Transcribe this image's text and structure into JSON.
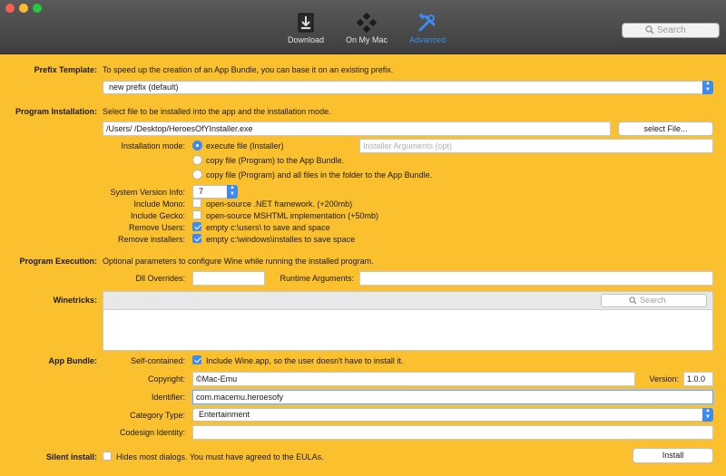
{
  "toolbar": {
    "tabs": [
      {
        "label": "Download",
        "icon": "download-icon"
      },
      {
        "label": "On My Mac",
        "icon": "on-my-mac-icon"
      },
      {
        "label": "Advanced",
        "icon": "advanced-tools-icon"
      }
    ],
    "active_tab": "Advanced",
    "search_placeholder": "Search"
  },
  "prefix": {
    "label": "Prefix Template:",
    "description": "To speed up the creation of an App Bundle, you can base it on an existing prefix.",
    "selected": "new prefix (default)"
  },
  "program_installation": {
    "label": "Program Installation:",
    "description": "Select file to be installed into the app and the installation mode.",
    "file_path": "/Users/            /Desktop/HeroesOfYInstaller.exe",
    "select_file_label": "select File...",
    "mode_label": "Installation mode:",
    "modes": [
      "execute file (Installer)",
      "copy file (Program)  to the App Bundle.",
      "copy file (Program)  and all files in the folder to the App Bundle."
    ],
    "installer_args_placeholder": "Installer Arguments (opt)",
    "system_version_label": "System Version Info:",
    "system_version": "7",
    "options": [
      {
        "label": "Include Mono:",
        "text": "open-source .NET framework. (+200mb)",
        "checked": false
      },
      {
        "label": "Include Gecko:",
        "text": "open-source MSHTML implementation (+50mb)",
        "checked": false
      },
      {
        "label": "Remove Users:",
        "text": "empty c:\\users\\ to save and space",
        "checked": true
      },
      {
        "label": "Remove installers:",
        "text": "empty c:\\windows\\installes to save space",
        "checked": true
      }
    ]
  },
  "program_execution": {
    "label": "Program Execution:",
    "description": "Optional parameters to configure Wine while running the installed program.",
    "dll_overrides_label": "Dll Overrides:",
    "runtime_args_label": "Runtime Arguments:"
  },
  "winetricks": {
    "label": "Winetricks:",
    "search_placeholder": "Search"
  },
  "app_bundle": {
    "label": "App Bundle:",
    "self_contained_label": "Self-contained:",
    "self_contained_text": "Include Wine.app, so the user doesn't have to install it.",
    "self_contained_checked": true,
    "copyright_label": "Copyright:",
    "copyright": "©Mac-Emu",
    "version_label": "Version:",
    "version": "1.0.0",
    "identifier_label": "Identifier:",
    "identifier": "com.macemu.heroesofy",
    "category_label": "Category Type:",
    "category": "Entertainment",
    "codesign_label": "Codesign Identity:"
  },
  "silent_install": {
    "label": "Silent install:",
    "text": "Hides most dialogs. You must have agreed to the EULAs.",
    "checked": false
  },
  "install_button": "Install",
  "colors": {
    "background": "#fbc02d",
    "accent": "#3d8bf2",
    "toolbar": "#4a4a4a"
  }
}
